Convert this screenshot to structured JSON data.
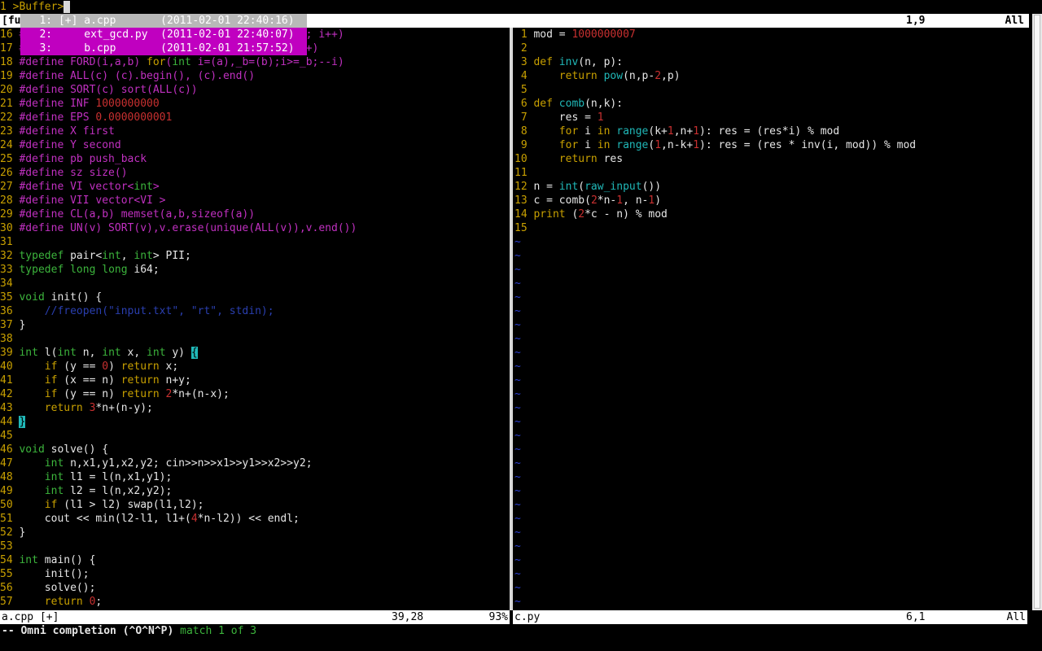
{
  "cmdline": {
    "num": "1",
    "text": ">Buffer>"
  },
  "tabline": {
    "label": "[fu",
    "pos": "1,9",
    "pct": "All"
  },
  "popup": [
    {
      "text": "1: [+] a.cpp       (2011-02-01 22:40:16)"
    },
    {
      "text": "2:     ext_gcd.py  (2011-02-01 22:40:07)"
    },
    {
      "text": "3:     b.cpp       (2011-02-01 21:57:52)"
    }
  ],
  "statusline": {
    "left": {
      "name": "a.cpp [+]",
      "pos": "39,28",
      "pct": "93%"
    },
    "right": {
      "name": "c.py",
      "pos": "6,1",
      "pct": "All"
    }
  },
  "message": {
    "mode": "-- Omni completion (^O^N^P)",
    "info": "match 1 of 3"
  },
  "left_lines": [
    [
      {
        "t": "16 ",
        "c": "ln"
      },
      {
        "t": "#define FOR(i,a,b) for(int i=(a),_b=(b);i< _n; i++)",
        "c": "pp"
      }
    ],
    [
      {
        "t": "17 ",
        "c": "ln"
      },
      {
        "t": "#define REP(i,n) for(int i=0,_n=(n);i< _n; i++)",
        "c": "pp"
      }
    ],
    [
      {
        "t": "18 ",
        "c": "ln"
      },
      {
        "t": "#define FORD(i,a,b) ",
        "c": "pp"
      },
      {
        "t": "for",
        "c": "kw"
      },
      {
        "t": "(",
        "c": "pp"
      },
      {
        "t": "int",
        "c": "ty"
      },
      {
        "t": " i=(a),_b=(b);i>=_b;--i)",
        "c": "pp"
      }
    ],
    [
      {
        "t": "19 ",
        "c": "ln"
      },
      {
        "t": "#define ALL(c) (c).begin(), (c).end()",
        "c": "pp"
      }
    ],
    [
      {
        "t": "20 ",
        "c": "ln"
      },
      {
        "t": "#define SORT(c) sort(ALL(c))",
        "c": "pp"
      }
    ],
    [
      {
        "t": "21 ",
        "c": "ln"
      },
      {
        "t": "#define INF ",
        "c": "pp"
      },
      {
        "t": "1000000000",
        "c": "nm"
      }
    ],
    [
      {
        "t": "22 ",
        "c": "ln"
      },
      {
        "t": "#define EPS ",
        "c": "pp"
      },
      {
        "t": "0.0000000001",
        "c": "nm"
      }
    ],
    [
      {
        "t": "23 ",
        "c": "ln"
      },
      {
        "t": "#define X first",
        "c": "pp"
      }
    ],
    [
      {
        "t": "24 ",
        "c": "ln"
      },
      {
        "t": "#define Y second",
        "c": "pp"
      }
    ],
    [
      {
        "t": "25 ",
        "c": "ln"
      },
      {
        "t": "#define pb push_back",
        "c": "pp"
      }
    ],
    [
      {
        "t": "26 ",
        "c": "ln"
      },
      {
        "t": "#define sz size()",
        "c": "pp"
      }
    ],
    [
      {
        "t": "27 ",
        "c": "ln"
      },
      {
        "t": "#define VI vector<",
        "c": "pp"
      },
      {
        "t": "int",
        "c": "ty"
      },
      {
        "t": ">",
        "c": "pp"
      }
    ],
    [
      {
        "t": "28 ",
        "c": "ln"
      },
      {
        "t": "#define VII vector<VI >",
        "c": "pp"
      }
    ],
    [
      {
        "t": "29 ",
        "c": "ln"
      },
      {
        "t": "#define CL(a,b) memset(a,b,sizeof(a))",
        "c": "pp"
      }
    ],
    [
      {
        "t": "30 ",
        "c": "ln"
      },
      {
        "t": "#define UN(v) SORT(v),v.erase(unique(ALL(v)),v.end())",
        "c": "pp"
      }
    ],
    [
      {
        "t": "31",
        "c": "ln"
      }
    ],
    [
      {
        "t": "32 ",
        "c": "ln"
      },
      {
        "t": "typedef",
        "c": "ty"
      },
      {
        "t": " pair<"
      },
      {
        "t": "int",
        "c": "ty"
      },
      {
        "t": ", "
      },
      {
        "t": "int",
        "c": "ty"
      },
      {
        "t": "> PII;"
      }
    ],
    [
      {
        "t": "33 ",
        "c": "ln"
      },
      {
        "t": "typedef",
        "c": "ty"
      },
      {
        "t": " "
      },
      {
        "t": "long long",
        "c": "ty"
      },
      {
        "t": " i64;"
      }
    ],
    [
      {
        "t": "34",
        "c": "ln"
      }
    ],
    [
      {
        "t": "35 ",
        "c": "ln"
      },
      {
        "t": "void",
        "c": "ty"
      },
      {
        "t": " init() {"
      }
    ],
    [
      {
        "t": "36 ",
        "c": "ln"
      },
      {
        "t": "    //freopen(\"input.txt\", \"rt\", stdin);",
        "c": "cm"
      }
    ],
    [
      {
        "t": "37 ",
        "c": "ln"
      },
      {
        "t": "}"
      }
    ],
    [
      {
        "t": "38",
        "c": "ln"
      }
    ],
    [
      {
        "t": "39 ",
        "c": "ln"
      },
      {
        "t": "int",
        "c": "ty"
      },
      {
        "t": " l("
      },
      {
        "t": "int",
        "c": "ty"
      },
      {
        "t": " n, "
      },
      {
        "t": "int",
        "c": "ty"
      },
      {
        "t": " x, "
      },
      {
        "t": "int",
        "c": "ty"
      },
      {
        "t": " y) "
      },
      {
        "t": "{",
        "c": "match"
      }
    ],
    [
      {
        "t": "40 ",
        "c": "ln"
      },
      {
        "t": "    "
      },
      {
        "t": "if",
        "c": "kw"
      },
      {
        "t": " (y == "
      },
      {
        "t": "0",
        "c": "nm"
      },
      {
        "t": ") "
      },
      {
        "t": "return",
        "c": "kw"
      },
      {
        "t": " x;"
      }
    ],
    [
      {
        "t": "41 ",
        "c": "ln"
      },
      {
        "t": "    "
      },
      {
        "t": "if",
        "c": "kw"
      },
      {
        "t": " (x == n) "
      },
      {
        "t": "return",
        "c": "kw"
      },
      {
        "t": " n+y;"
      }
    ],
    [
      {
        "t": "42 ",
        "c": "ln"
      },
      {
        "t": "    "
      },
      {
        "t": "if",
        "c": "kw"
      },
      {
        "t": " (y == n) "
      },
      {
        "t": "return",
        "c": "kw"
      },
      {
        "t": " "
      },
      {
        "t": "2",
        "c": "nm"
      },
      {
        "t": "*n+(n-x);"
      }
    ],
    [
      {
        "t": "43 ",
        "c": "ln"
      },
      {
        "t": "    "
      },
      {
        "t": "return",
        "c": "kw"
      },
      {
        "t": " "
      },
      {
        "t": "3",
        "c": "nm"
      },
      {
        "t": "*n+(n-y);"
      }
    ],
    [
      {
        "t": "44 ",
        "c": "ln"
      },
      {
        "t": "}",
        "c": "match"
      }
    ],
    [
      {
        "t": "45",
        "c": "ln"
      }
    ],
    [
      {
        "t": "46 ",
        "c": "ln"
      },
      {
        "t": "void",
        "c": "ty"
      },
      {
        "t": " solve() {"
      }
    ],
    [
      {
        "t": "47 ",
        "c": "ln"
      },
      {
        "t": "    "
      },
      {
        "t": "int",
        "c": "ty"
      },
      {
        "t": " n,x1,y1,x2,y2; cin>>n>>x1>>y1>>x2>>y2;"
      }
    ],
    [
      {
        "t": "48 ",
        "c": "ln"
      },
      {
        "t": "    "
      },
      {
        "t": "int",
        "c": "ty"
      },
      {
        "t": " l1 = l(n,x1,y1);"
      }
    ],
    [
      {
        "t": "49 ",
        "c": "ln"
      },
      {
        "t": "    "
      },
      {
        "t": "int",
        "c": "ty"
      },
      {
        "t": " l2 = l(n,x2,y2);"
      }
    ],
    [
      {
        "t": "50 ",
        "c": "ln"
      },
      {
        "t": "    "
      },
      {
        "t": "if",
        "c": "kw"
      },
      {
        "t": " (l1 > l2) swap(l1,l2);"
      }
    ],
    [
      {
        "t": "51 ",
        "c": "ln"
      },
      {
        "t": "    cout << min(l2-l1, l1+("
      },
      {
        "t": "4",
        "c": "nm"
      },
      {
        "t": "*n-l2)) << endl;"
      }
    ],
    [
      {
        "t": "52 ",
        "c": "ln"
      },
      {
        "t": "}"
      }
    ],
    [
      {
        "t": "53",
        "c": "ln"
      }
    ],
    [
      {
        "t": "54 ",
        "c": "ln"
      },
      {
        "t": "int",
        "c": "ty"
      },
      {
        "t": " main() {"
      }
    ],
    [
      {
        "t": "55 ",
        "c": "ln"
      },
      {
        "t": "    init();"
      }
    ],
    [
      {
        "t": "56 ",
        "c": "ln"
      },
      {
        "t": "    solve();"
      }
    ],
    [
      {
        "t": "57 ",
        "c": "ln"
      },
      {
        "t": "    "
      },
      {
        "t": "return",
        "c": "kw"
      },
      {
        "t": " "
      },
      {
        "t": "0",
        "c": "nm"
      },
      {
        "t": ";"
      }
    ]
  ],
  "right_lines": [
    [
      {
        "t": " 1 ",
        "c": "ln"
      },
      {
        "t": "mod = "
      },
      {
        "t": "1000000007",
        "c": "nm"
      }
    ],
    [
      {
        "t": " 2",
        "c": "ln"
      }
    ],
    [
      {
        "t": " 3 ",
        "c": "ln"
      },
      {
        "t": "def",
        "c": "kw"
      },
      {
        "t": " "
      },
      {
        "t": "inv",
        "c": "bi"
      },
      {
        "t": "(n, p):"
      }
    ],
    [
      {
        "t": " 4 ",
        "c": "ln"
      },
      {
        "t": "    "
      },
      {
        "t": "return",
        "c": "kw"
      },
      {
        "t": " "
      },
      {
        "t": "pow",
        "c": "bi"
      },
      {
        "t": "(n,p-"
      },
      {
        "t": "2",
        "c": "nm"
      },
      {
        "t": ",p)"
      }
    ],
    [
      {
        "t": " 5",
        "c": "ln"
      }
    ],
    [
      {
        "t": " 6 ",
        "c": "ln"
      },
      {
        "t": "def",
        "c": "kw"
      },
      {
        "t": " "
      },
      {
        "t": "comb",
        "c": "bi"
      },
      {
        "t": "(n,k):"
      }
    ],
    [
      {
        "t": " 7 ",
        "c": "ln"
      },
      {
        "t": "    res = "
      },
      {
        "t": "1",
        "c": "nm"
      }
    ],
    [
      {
        "t": " 8 ",
        "c": "ln"
      },
      {
        "t": "    "
      },
      {
        "t": "for",
        "c": "kw"
      },
      {
        "t": " i "
      },
      {
        "t": "in",
        "c": "kw"
      },
      {
        "t": " "
      },
      {
        "t": "range",
        "c": "bi"
      },
      {
        "t": "(k+"
      },
      {
        "t": "1",
        "c": "nm"
      },
      {
        "t": ",n+"
      },
      {
        "t": "1",
        "c": "nm"
      },
      {
        "t": "): res = (res*i) % mod"
      }
    ],
    [
      {
        "t": " 9 ",
        "c": "ln"
      },
      {
        "t": "    "
      },
      {
        "t": "for",
        "c": "kw"
      },
      {
        "t": " i "
      },
      {
        "t": "in",
        "c": "kw"
      },
      {
        "t": " "
      },
      {
        "t": "range",
        "c": "bi"
      },
      {
        "t": "("
      },
      {
        "t": "1",
        "c": "nm"
      },
      {
        "t": ",n-k+"
      },
      {
        "t": "1",
        "c": "nm"
      },
      {
        "t": "): res = (res * inv(i, mod)) % mod"
      }
    ],
    [
      {
        "t": "10 ",
        "c": "ln"
      },
      {
        "t": "    "
      },
      {
        "t": "return",
        "c": "kw"
      },
      {
        "t": " res"
      }
    ],
    [
      {
        "t": "11",
        "c": "ln"
      }
    ],
    [
      {
        "t": "12 ",
        "c": "ln"
      },
      {
        "t": "n = "
      },
      {
        "t": "int",
        "c": "bi"
      },
      {
        "t": "("
      },
      {
        "t": "raw_input",
        "c": "bi"
      },
      {
        "t": "())"
      }
    ],
    [
      {
        "t": "13 ",
        "c": "ln"
      },
      {
        "t": "c = comb("
      },
      {
        "t": "2",
        "c": "nm"
      },
      {
        "t": "*n-"
      },
      {
        "t": "1",
        "c": "nm"
      },
      {
        "t": ", n-"
      },
      {
        "t": "1",
        "c": "nm"
      },
      {
        "t": ")"
      }
    ],
    [
      {
        "t": "14 ",
        "c": "ln"
      },
      {
        "t": "print",
        "c": "kw"
      },
      {
        "t": " ("
      },
      {
        "t": "2",
        "c": "nm"
      },
      {
        "t": "*c - n) % mod"
      }
    ],
    [
      {
        "t": "15",
        "c": "ln"
      }
    ],
    [
      {
        "t": "~",
        "c": "tilde"
      }
    ],
    [
      {
        "t": "~",
        "c": "tilde"
      }
    ],
    [
      {
        "t": "~",
        "c": "tilde"
      }
    ],
    [
      {
        "t": "~",
        "c": "tilde"
      }
    ],
    [
      {
        "t": "~",
        "c": "tilde"
      }
    ],
    [
      {
        "t": "~",
        "c": "tilde"
      }
    ],
    [
      {
        "t": "~",
        "c": "tilde"
      }
    ],
    [
      {
        "t": "~",
        "c": "tilde"
      }
    ],
    [
      {
        "t": "~",
        "c": "tilde"
      }
    ],
    [
      {
        "t": "~",
        "c": "tilde"
      }
    ],
    [
      {
        "t": "~",
        "c": "tilde"
      }
    ],
    [
      {
        "t": "~",
        "c": "tilde"
      }
    ],
    [
      {
        "t": "~",
        "c": "tilde"
      }
    ],
    [
      {
        "t": "~",
        "c": "tilde"
      }
    ],
    [
      {
        "t": "~",
        "c": "tilde"
      }
    ],
    [
      {
        "t": "~",
        "c": "tilde"
      }
    ],
    [
      {
        "t": "~",
        "c": "tilde"
      }
    ],
    [
      {
        "t": "~",
        "c": "tilde"
      }
    ],
    [
      {
        "t": "~",
        "c": "tilde"
      }
    ],
    [
      {
        "t": "~",
        "c": "tilde"
      }
    ],
    [
      {
        "t": "~",
        "c": "tilde"
      }
    ],
    [
      {
        "t": "~",
        "c": "tilde"
      }
    ],
    [
      {
        "t": "~",
        "c": "tilde"
      }
    ],
    [
      {
        "t": "~",
        "c": "tilde"
      }
    ],
    [
      {
        "t": "~",
        "c": "tilde"
      }
    ],
    [
      {
        "t": "~",
        "c": "tilde"
      }
    ],
    [
      {
        "t": "~",
        "c": "tilde"
      }
    ]
  ]
}
